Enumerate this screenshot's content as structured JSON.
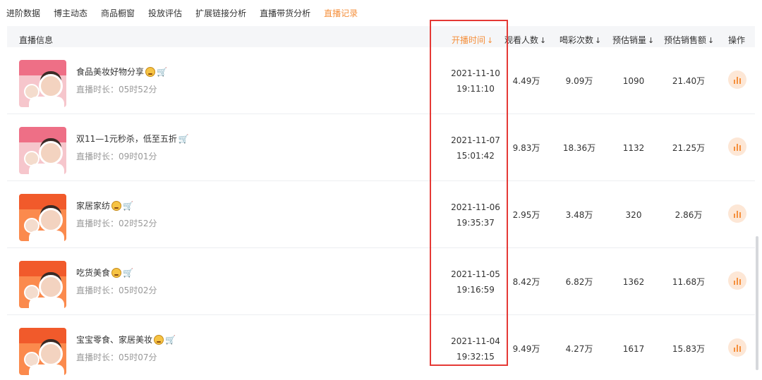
{
  "tabs": [
    {
      "label": "进阶数据"
    },
    {
      "label": "博主动态"
    },
    {
      "label": "商品橱窗"
    },
    {
      "label": "投放评估"
    },
    {
      "label": "扩展链接分析"
    },
    {
      "label": "直播带货分析"
    },
    {
      "label": "直播记录",
      "active": true
    }
  ],
  "table": {
    "headers": {
      "info": "直播信息",
      "start_time": "开播时间",
      "viewers": "观看人数",
      "cheers": "喝彩次数",
      "est_sales": "预估销量",
      "est_revenue": "预估销售额",
      "ops": "操作"
    },
    "sort_arrow": "↓",
    "rows": [
      {
        "title": "食品美妆好物分享",
        "duration": "直播时长：05时52分",
        "date": "2021-11-10",
        "time": "19:11:10",
        "viewers": "4.49万",
        "cheers": "9.09万",
        "sales": "1090",
        "revenue": "21.40万"
      },
      {
        "title": "双11—1元秒杀，低至五折",
        "duration": "直播时长：09时01分",
        "date": "2021-11-07",
        "time": "15:01:42",
        "viewers": "9.83万",
        "cheers": "18.36万",
        "sales": "1132",
        "revenue": "21.25万"
      },
      {
        "title": "家居家纺",
        "duration": "直播时长：02时52分",
        "date": "2021-11-06",
        "time": "19:35:37",
        "viewers": "2.95万",
        "cheers": "3.48万",
        "sales": "320",
        "revenue": "2.86万"
      },
      {
        "title": "吃货美食",
        "duration": "直播时长：05时02分",
        "date": "2021-11-05",
        "time": "19:16:59",
        "viewers": "8.42万",
        "cheers": "6.82万",
        "sales": "1362",
        "revenue": "11.68万"
      },
      {
        "title": "宝宝零食、家居美妆",
        "duration": "直播时长：05时07分",
        "date": "2021-11-04",
        "time": "19:32:15",
        "viewers": "9.49万",
        "cheers": "4.27万",
        "sales": "1617",
        "revenue": "15.83万"
      }
    ]
  },
  "colors": {
    "accent": "#f5903d",
    "highlight_box": "#e53935",
    "header_bg": "#f5f6f8"
  },
  "icons": {
    "emoji": "star-struck-emoji-icon",
    "cart": "cart-icon",
    "ops": "bar-chart-icon"
  }
}
